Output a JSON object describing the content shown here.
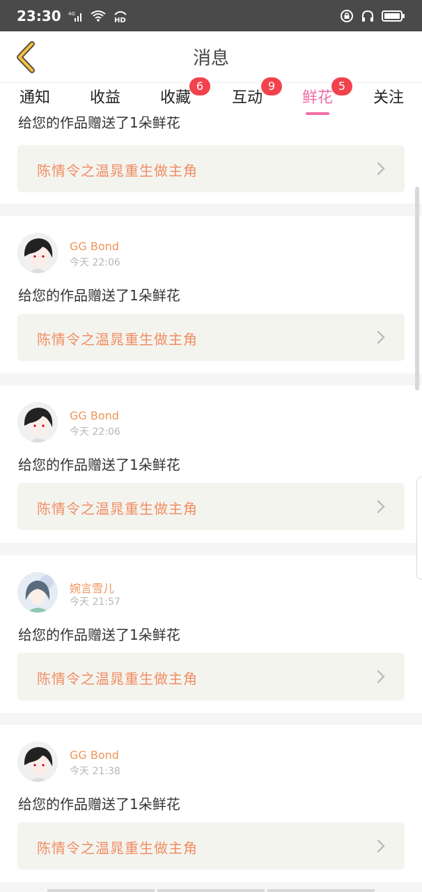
{
  "status_bar": {
    "time": "23:30",
    "network": "4G",
    "hd": "HD"
  },
  "header": {
    "title": "消息"
  },
  "tabs": [
    {
      "label": "通知",
      "badge": ""
    },
    {
      "label": "收益",
      "badge": ""
    },
    {
      "label": "收藏",
      "badge": "6"
    },
    {
      "label": "互动",
      "badge": "9"
    },
    {
      "label": "鲜花",
      "badge": "5",
      "active": true
    },
    {
      "label": "关注",
      "badge": ""
    }
  ],
  "messages": [
    {
      "partial": true,
      "text": "给您的作品赠送了1朵鲜花",
      "work_title": "陈情令之温晁重生做主角"
    },
    {
      "name": "GG Bond",
      "time": "今天 22:06",
      "text": "给您的作品赠送了1朵鲜花",
      "work_title": "陈情令之温晁重生做主角",
      "avatar": "boy-dark-hair"
    },
    {
      "name": "GG Bond",
      "time": "今天 22:06",
      "text": "给您的作品赠送了1朵鲜花",
      "work_title": "陈情令之温晁重生做主角",
      "avatar": "boy-dark-hair"
    },
    {
      "name": "婉言雪儿",
      "time": "今天 21:57",
      "text": "给您的作品赠送了1朵鲜花",
      "work_title": "陈情令之温晁重生做主角",
      "avatar": "girl-pastel"
    },
    {
      "name": "GG Bond",
      "time": "今天 21:38",
      "text": "给您的作品赠送了1朵鲜花",
      "work_title": "陈情令之温晁重生做主角",
      "avatar": "boy-dark-hair"
    }
  ],
  "colors": {
    "accent_pink": "#f06ea6",
    "badge_red": "#f2434d",
    "name_orange": "#f0955a",
    "work_title_orange": "#f08d63"
  }
}
